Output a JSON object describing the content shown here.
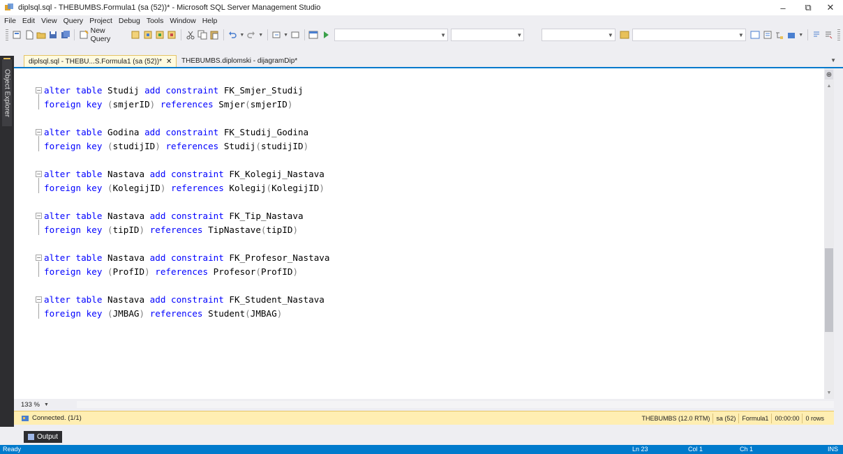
{
  "window": {
    "title": "diplsql.sql - THEBUMBS.Formula1 (sa (52))* - Microsoft SQL Server Management Studio",
    "minimize_glyph": "–",
    "maximize_glyph": "⧉",
    "close_glyph": "✕"
  },
  "menu": [
    "File",
    "Edit",
    "View",
    "Query",
    "Project",
    "Debug",
    "Tools",
    "Window",
    "Help"
  ],
  "toolbar": {
    "new_query_label": "New Query"
  },
  "side_panel": {
    "label": "Object Explorer"
  },
  "tabs": [
    {
      "label": "diplsql.sql - THEBU...S.Formula1 (sa (52))*",
      "close": "✕",
      "active": true
    },
    {
      "label": "THEBUMBS.diplomski - dijagramDip*",
      "active": false
    }
  ],
  "code": [
    [
      {
        "t": "alter table ",
        "c": "kw"
      },
      {
        "t": "Studij "
      },
      {
        "t": "add constraint ",
        "c": "kw"
      },
      {
        "t": "FK_Smjer_Studij"
      }
    ],
    [
      {
        "t": "foreign key ",
        "c": "kw"
      },
      {
        "t": "(",
        "c": "gr"
      },
      {
        "t": "smjerID"
      },
      {
        "t": ") ",
        "c": "gr"
      },
      {
        "t": "references ",
        "c": "kw"
      },
      {
        "t": "Smjer"
      },
      {
        "t": "(",
        "c": "gr"
      },
      {
        "t": "smjerID"
      },
      {
        "t": ")",
        "c": "gr"
      }
    ],
    [],
    [
      {
        "t": "alter table ",
        "c": "kw"
      },
      {
        "t": "Godina "
      },
      {
        "t": "add constraint ",
        "c": "kw"
      },
      {
        "t": "FK_Studij_Godina"
      }
    ],
    [
      {
        "t": "foreign key ",
        "c": "kw"
      },
      {
        "t": "(",
        "c": "gr"
      },
      {
        "t": "studijID"
      },
      {
        "t": ") ",
        "c": "gr"
      },
      {
        "t": "references ",
        "c": "kw"
      },
      {
        "t": "Studij"
      },
      {
        "t": "(",
        "c": "gr"
      },
      {
        "t": "studijID"
      },
      {
        "t": ")",
        "c": "gr"
      }
    ],
    [],
    [
      {
        "t": "alter table ",
        "c": "kw"
      },
      {
        "t": "Nastava "
      },
      {
        "t": "add constraint ",
        "c": "kw"
      },
      {
        "t": "FK_Kolegij_Nastava"
      }
    ],
    [
      {
        "t": "foreign key ",
        "c": "kw"
      },
      {
        "t": "(",
        "c": "gr"
      },
      {
        "t": "KolegijID"
      },
      {
        "t": ") ",
        "c": "gr"
      },
      {
        "t": "references ",
        "c": "kw"
      },
      {
        "t": "Kolegij"
      },
      {
        "t": "(",
        "c": "gr"
      },
      {
        "t": "KolegijID"
      },
      {
        "t": ")",
        "c": "gr"
      }
    ],
    [],
    [
      {
        "t": "alter table ",
        "c": "kw"
      },
      {
        "t": "Nastava "
      },
      {
        "t": "add constraint ",
        "c": "kw"
      },
      {
        "t": "FK_Tip_Nastava"
      }
    ],
    [
      {
        "t": "foreign key ",
        "c": "kw"
      },
      {
        "t": "(",
        "c": "gr"
      },
      {
        "t": "tipID"
      },
      {
        "t": ") ",
        "c": "gr"
      },
      {
        "t": "references ",
        "c": "kw"
      },
      {
        "t": "TipNastave"
      },
      {
        "t": "(",
        "c": "gr"
      },
      {
        "t": "tipID"
      },
      {
        "t": ")",
        "c": "gr"
      }
    ],
    [],
    [
      {
        "t": "alter table ",
        "c": "kw"
      },
      {
        "t": "Nastava "
      },
      {
        "t": "add constraint ",
        "c": "kw"
      },
      {
        "t": "FK_Profesor_Nastava"
      }
    ],
    [
      {
        "t": "foreign key ",
        "c": "kw"
      },
      {
        "t": "(",
        "c": "gr"
      },
      {
        "t": "ProfID"
      },
      {
        "t": ") ",
        "c": "gr"
      },
      {
        "t": "references ",
        "c": "kw"
      },
      {
        "t": "Profesor"
      },
      {
        "t": "(",
        "c": "gr"
      },
      {
        "t": "ProfID"
      },
      {
        "t": ")",
        "c": "gr"
      }
    ],
    [],
    [
      {
        "t": "alter table ",
        "c": "kw"
      },
      {
        "t": "Nastava "
      },
      {
        "t": "add constraint ",
        "c": "kw"
      },
      {
        "t": "FK_Student_Nastava"
      }
    ],
    [
      {
        "t": "foreign key ",
        "c": "kw"
      },
      {
        "t": "(",
        "c": "gr"
      },
      {
        "t": "JMBAG"
      },
      {
        "t": ") ",
        "c": "gr"
      },
      {
        "t": "references ",
        "c": "kw"
      },
      {
        "t": "Student"
      },
      {
        "t": "(",
        "c": "gr"
      },
      {
        "t": "JMBAG"
      },
      {
        "t": ")",
        "c": "gr"
      }
    ]
  ],
  "zoom": "133 %",
  "query_status": {
    "connection": "Connected. (1/1)",
    "server": "THEBUMBS (12.0 RTM)",
    "user": "sa (52)",
    "database": "Formula1",
    "time": "00:00:00",
    "rows": "0 rows"
  },
  "output_tab": "Output",
  "status": {
    "ready": "Ready",
    "ln": "Ln 23",
    "col": "Col 1",
    "ch": "Ch 1",
    "ins": "INS"
  },
  "colors": {
    "keyword": "#0000ff",
    "punctuation": "#808080",
    "status_bar": "#007acc",
    "query_status_bar": "#ffeeb2"
  }
}
